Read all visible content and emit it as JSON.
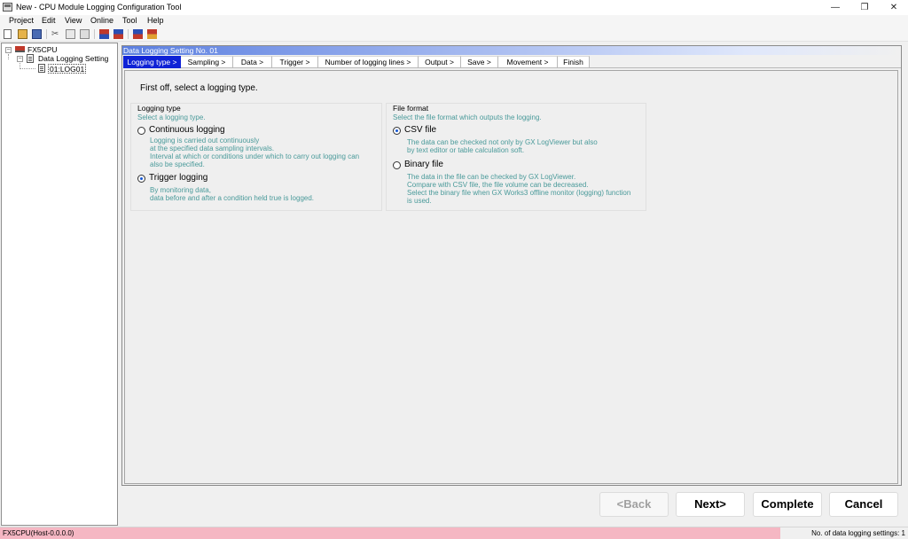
{
  "window": {
    "title": "New - CPU Module Logging Configuration Tool",
    "minimize": "—",
    "restore": "❐",
    "close": "✕"
  },
  "menu": [
    "Project",
    "Edit",
    "View",
    "Online",
    "Tool",
    "Help"
  ],
  "toolbar_icons": [
    "new-icon",
    "open-icon",
    "save-icon",
    "cut-icon",
    "copy-icon",
    "paste-icon",
    "write-to-cpu-icon",
    "read-from-cpu-icon",
    "connection-icon",
    "monitor-icon"
  ],
  "tree": {
    "root": "FX5CPU",
    "child": "Data Logging Setting",
    "leaf": "01:LOG01"
  },
  "panel": {
    "header": "Data Logging Setting No. 01",
    "steps": [
      "Logging type >",
      "Sampling >",
      "Data >",
      "Trigger >",
      "Number of logging lines >",
      "Output >",
      "Save >",
      "Movement >",
      "Finish"
    ],
    "headline": "First off, select a logging type."
  },
  "logging_type": {
    "title": "Logging type",
    "desc": "Select a logging type.",
    "continuous": {
      "label": "Continuous logging",
      "notes": [
        "Logging is carried out continuously",
        "at the specified data sampling intervals.",
        "Interval at which or conditions under which to carry out logging can",
        "also be specified."
      ]
    },
    "trigger": {
      "label": "Trigger logging",
      "notes": [
        "By monitoring data,",
        "data before and after a condition held true is logged."
      ]
    },
    "selected": "trigger"
  },
  "file_format": {
    "title": "File format",
    "desc": "Select the file format which outputs the logging.",
    "csv": {
      "label": "CSV file",
      "notes": [
        "The data can be checked not only by GX LogViewer but also",
        "by text editor or table calculation soft."
      ]
    },
    "binary": {
      "label": "Binary file",
      "notes": [
        "The data in the file can be checked by GX LogViewer.",
        "Compare with CSV file, the file volume can be decreased.",
        "Select the binary file when GX Works3 offline monitor (logging) function",
        "is used."
      ]
    },
    "selected": "csv"
  },
  "buttons": {
    "back": "<Back",
    "next": "Next>",
    "complete": "Complete",
    "cancel": "Cancel"
  },
  "status": {
    "left": "FX5CPU(Host-0.0.0.0)",
    "right": "No. of data logging settings: 1"
  },
  "colors": {
    "active_step": "#0f22d6",
    "radio_dot": "#1557d4",
    "note_text": "#4a9a9a",
    "status_pink": "#f5b7c3"
  }
}
